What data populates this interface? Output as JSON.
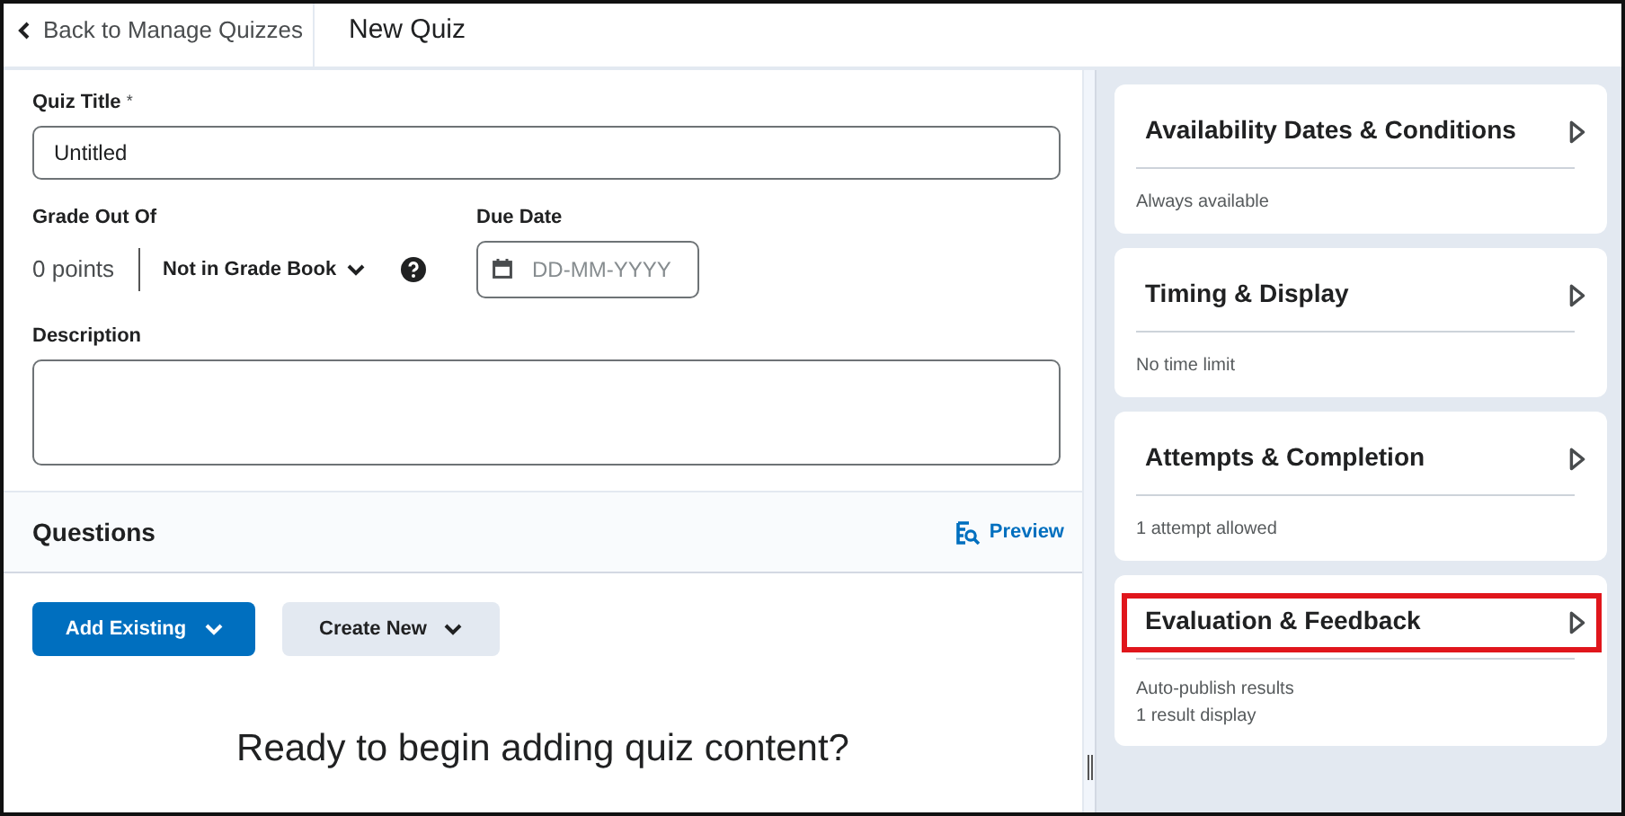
{
  "header": {
    "back_link": "Back to Manage Quizzes",
    "title": "New Quiz"
  },
  "form": {
    "title_label": "Quiz Title",
    "required_mark": "*",
    "title_value": "Untitled",
    "grade_label": "Grade Out Of",
    "points": "0 points",
    "grade_book": "Not in Grade Book",
    "due_label": "Due Date",
    "due_placeholder": "DD-MM-YYYY",
    "description_label": "Description"
  },
  "questions": {
    "heading": "Questions",
    "preview": "Preview",
    "buttons": [
      {
        "label": "Add Existing",
        "kind": "primary"
      },
      {
        "label": "Create New",
        "kind": "secondary"
      }
    ],
    "empty_message": "Ready to begin adding quiz content?"
  },
  "panels": [
    {
      "title": "Availability Dates & Conditions",
      "summary": [
        "Always available"
      ],
      "highlighted": false
    },
    {
      "title": "Timing & Display",
      "summary": [
        "No time limit"
      ],
      "highlighted": false
    },
    {
      "title": "Attempts & Completion",
      "summary": [
        "1 attempt allowed"
      ],
      "highlighted": false
    },
    {
      "title": "Evaluation & Feedback",
      "summary": [
        "Auto-publish results",
        "1 result display"
      ],
      "highlighted": true
    }
  ]
}
